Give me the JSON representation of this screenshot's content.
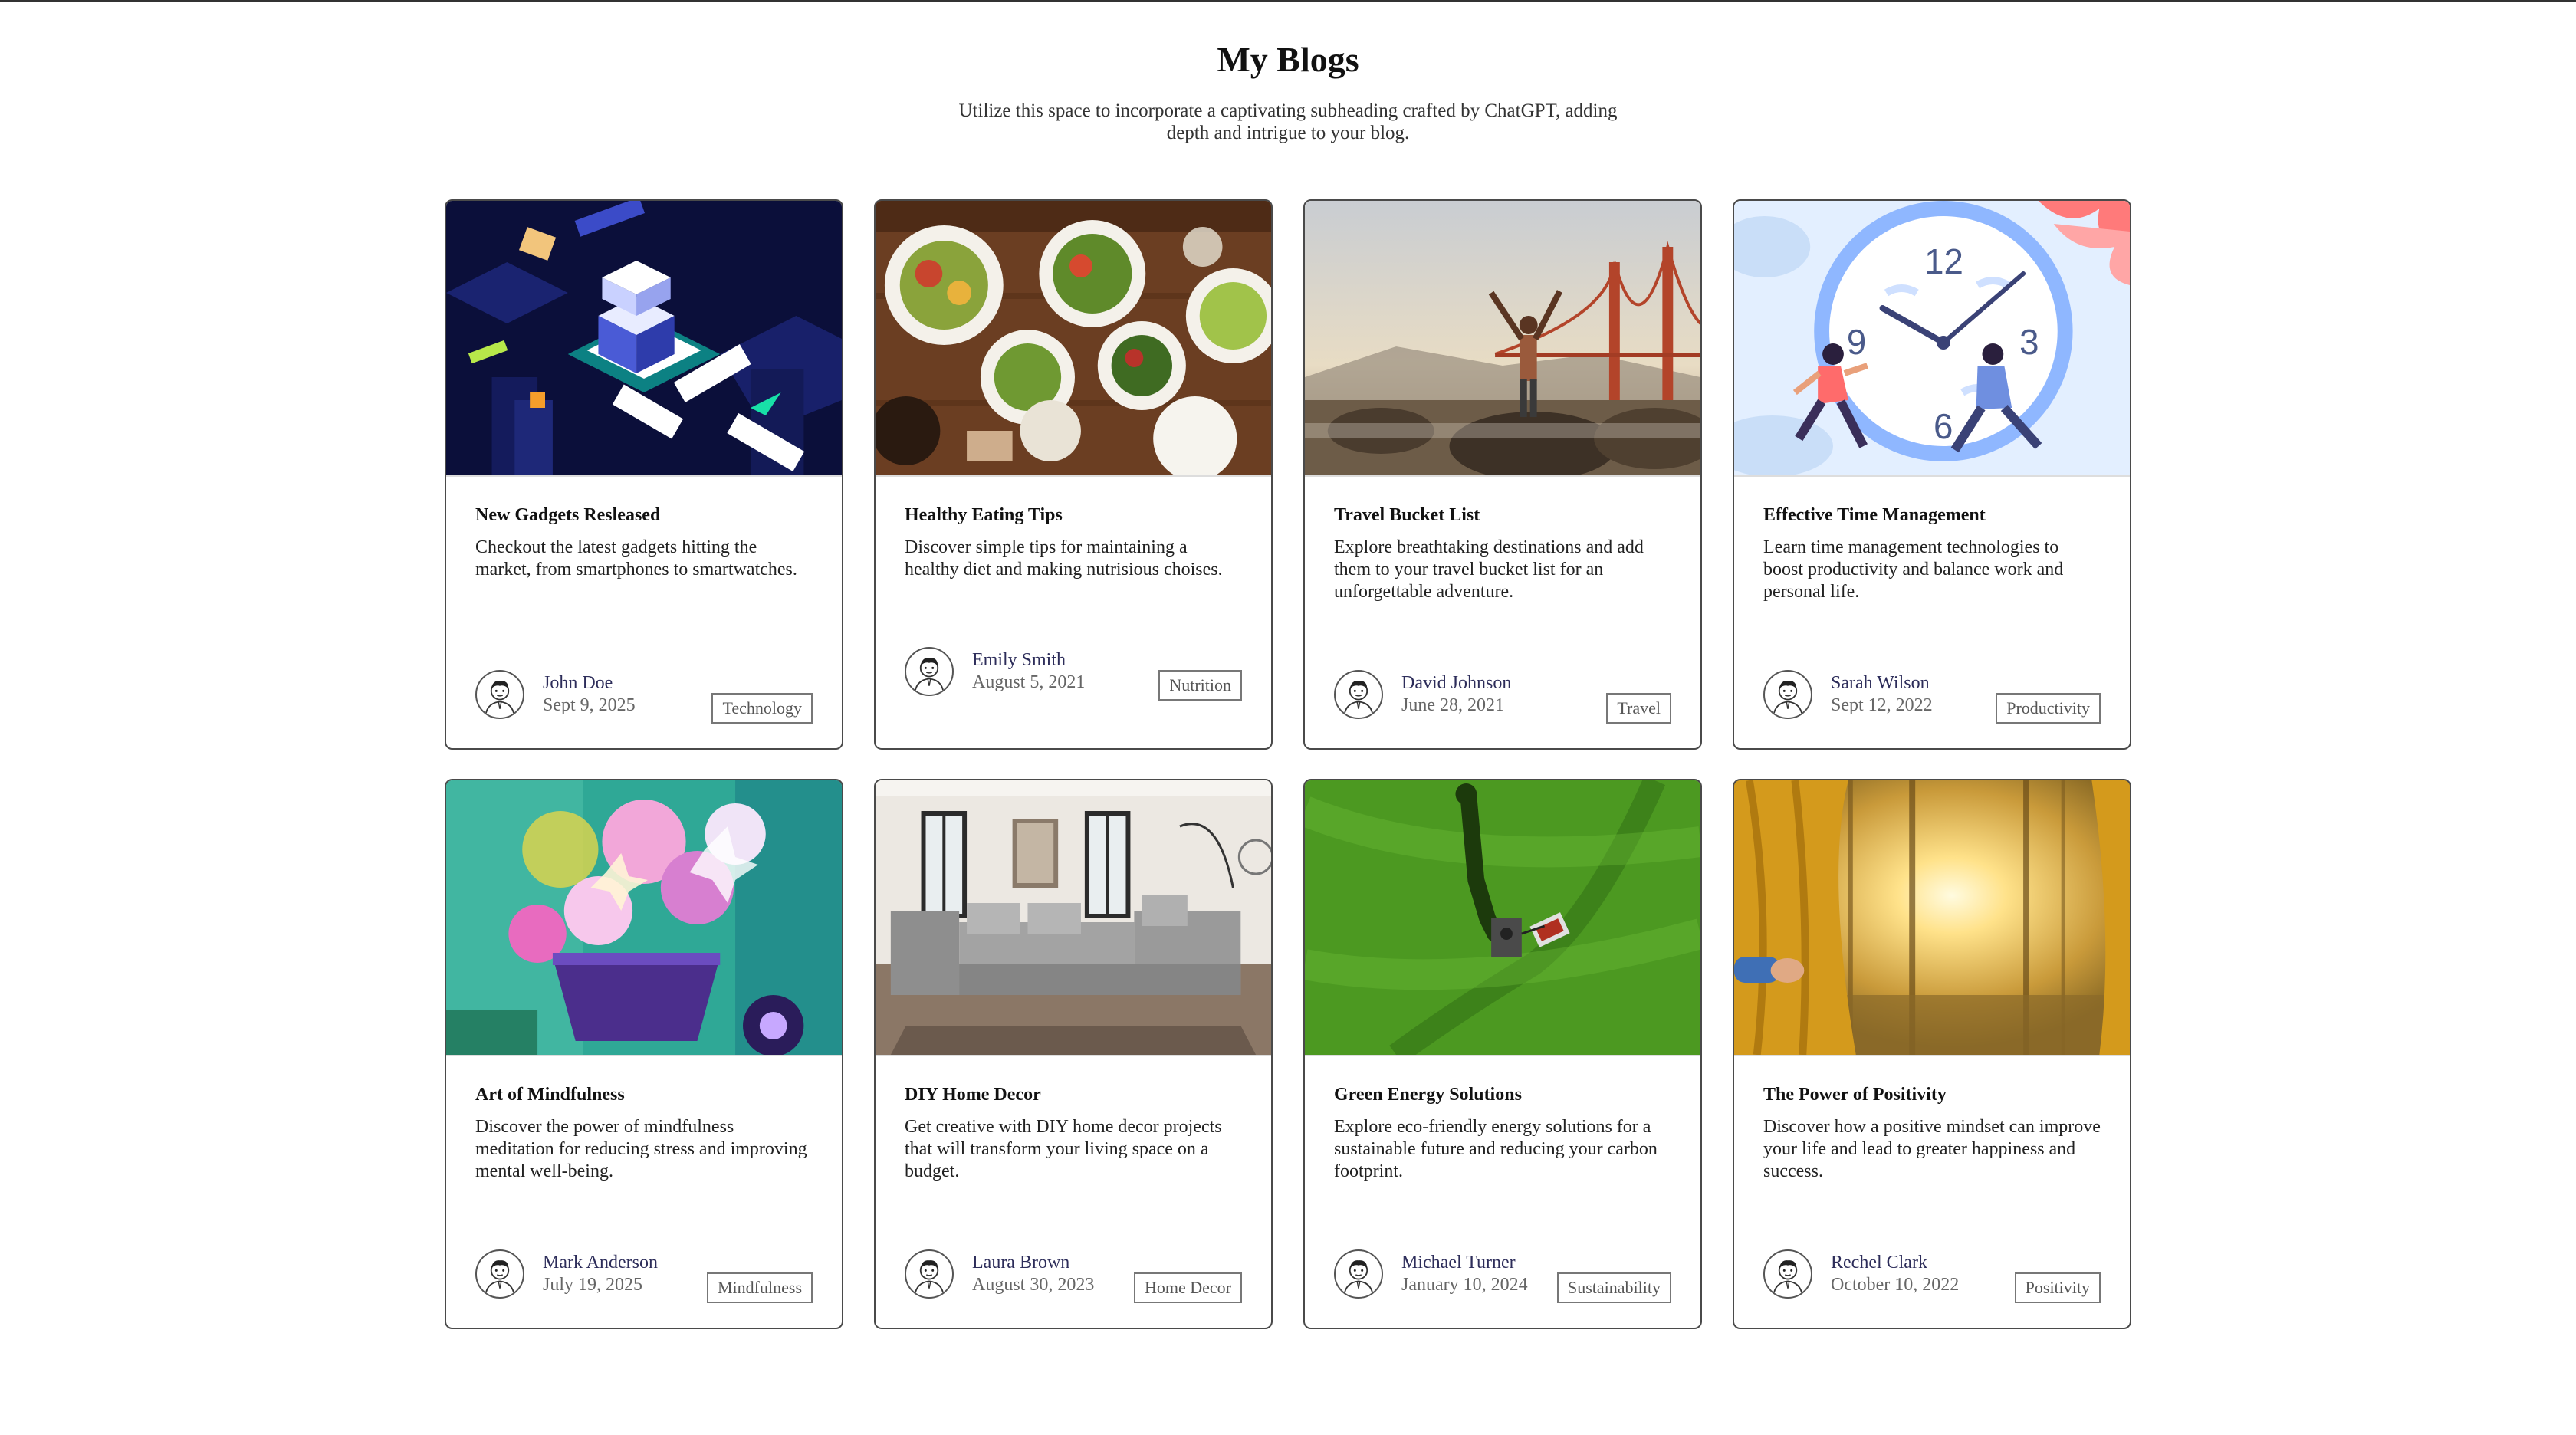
{
  "header": {
    "title": "My Blogs",
    "subheading": "Utilize this space to incorporate a captivating subheading crafted by ChatGPT, adding depth and intrigue to your blog."
  },
  "posts": [
    {
      "title": "New Gadgets Resleased",
      "description": "Checkout the latest gadgets hitting the market, from smartphones to smartwatches.",
      "author": "John Doe",
      "date": "Sept 9, 2025",
      "tag": "Technology",
      "image": "isometric-tech-illustration"
    },
    {
      "title": "Healthy Eating Tips",
      "description": "Discover simple tips for maintaining a healthy diet and making nutrisious choises.",
      "author": "Emily Smith",
      "date": "August 5, 2021",
      "tag": "Nutrition",
      "image": "food-table-photo"
    },
    {
      "title": "Travel Bucket List",
      "description": "Explore breathtaking destinations and add them to your travel bucket list for an unforgettable adventure.",
      "author": "David Johnson",
      "date": "June 28, 2021",
      "tag": "Travel",
      "image": "golden-gate-traveler-photo"
    },
    {
      "title": "Effective Time Management",
      "description": "Learn time management technologies to boost productivity and balance work and personal life.",
      "author": "Sarah Wilson",
      "date": "Sept 12, 2022",
      "tag": "Productivity",
      "image": "clock-runners-illustration"
    },
    {
      "title": "Art of Mindfulness",
      "description": "Discover the power of mindfulness meditation for reducing stress and improving mental well-being.",
      "author": "Mark Anderson",
      "date": "July 19, 2025",
      "tag": "Mindfulness",
      "image": "flower-painting"
    },
    {
      "title": "DIY Home Decor",
      "description": "Get creative with DIY home decor projects that will transform your living space on a budget.",
      "author": "Laura Brown",
      "date": "August 30, 2023",
      "tag": "Home Decor",
      "image": "living-room-sofa-photo"
    },
    {
      "title": "Green Energy Solutions",
      "description": "Explore eco-friendly energy solutions for a sustainable future and reducing your carbon footprint.",
      "author": "Michael Turner",
      "date": "January 10, 2024",
      "tag": "Sustainability",
      "image": "lawn-mowing-aerial-photo"
    },
    {
      "title": "The Power of Positivity",
      "description": "Discover how a positive mindset can improve your life and lead to greater happiness and success.",
      "author": "Rechel Clark",
      "date": "October 10, 2022",
      "tag": "Positivity",
      "image": "curtain-sunlight-forest-photo"
    }
  ]
}
